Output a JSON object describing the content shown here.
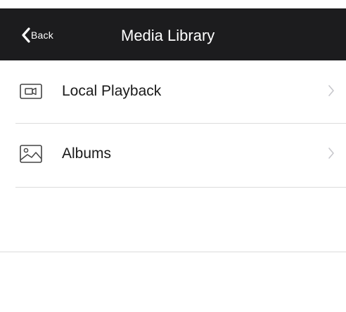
{
  "navbar": {
    "back_label": "Back",
    "title": "Media Library",
    "background": "#1c1c1e"
  },
  "list": {
    "items": [
      {
        "label": "Local Playback",
        "icon": "video-camera-icon"
      },
      {
        "label": "Albums",
        "icon": "photo-album-icon"
      }
    ]
  }
}
